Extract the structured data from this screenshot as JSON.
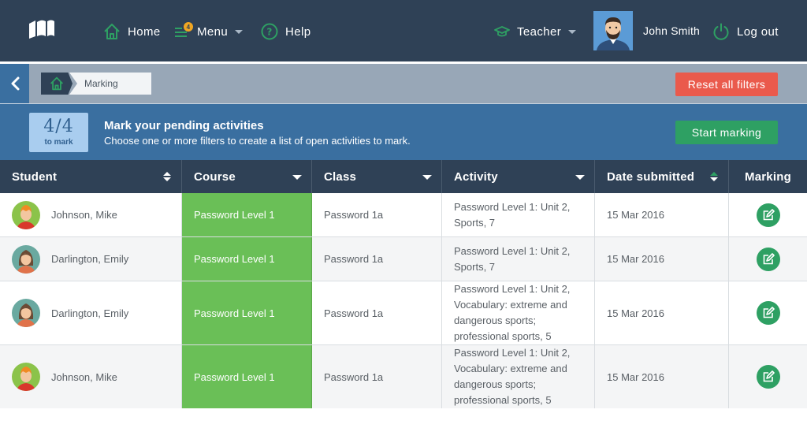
{
  "nav": {
    "home_label": "Home",
    "menu_label": "Menu",
    "menu_badge": "4",
    "help_label": "Help",
    "role_label": "Teacher",
    "user_name": "John Smith",
    "logout_label": "Log out"
  },
  "breadcrumb": {
    "current": "Marking"
  },
  "filters": {
    "reset_label": "Reset all filters"
  },
  "pending": {
    "count": "4/4",
    "count_sub": "to mark",
    "title": "Mark your pending activities",
    "description": "Choose one or more filters to create a list of open activities to mark.",
    "start_label": "Start marking"
  },
  "table": {
    "headers": {
      "student": "Student",
      "course": "Course",
      "class": "Class",
      "activity": "Activity",
      "date": "Date submitted",
      "marking": "Marking"
    },
    "rows": [
      {
        "student": "Johnson, Mike",
        "course": "Password Level 1",
        "class": "Password 1a",
        "activity": "Password Level 1: Unit 2, Sports, 7",
        "date": "15 Mar 2016",
        "avatar": "male-icon"
      },
      {
        "student": "Darlington, Emily",
        "course": "Password Level 1",
        "class": "Password 1a",
        "activity": "Password Level 1: Unit 2, Sports, 7",
        "date": "15 Mar 2016",
        "avatar": "female-icon"
      },
      {
        "student": "Darlington, Emily",
        "course": "Password Level 1",
        "class": "Password 1a",
        "activity": "Password Level 1: Unit 2, Vocabulary: extreme and dangerous sports; professional sports, 5",
        "date": "15 Mar 2016",
        "avatar": "female-icon"
      },
      {
        "student": "Johnson, Mike",
        "course": "Password Level 1",
        "class": "Password 1a",
        "activity": "Password Level 1: Unit 2, Vocabulary: extreme and dangerous sports; professional sports, 5",
        "date": "15 Mar 2016",
        "avatar": "male-icon"
      }
    ]
  },
  "colors": {
    "nav_bg": "#2f4156",
    "accent_green": "#2ea063",
    "course_green": "#6abf57",
    "reset_red": "#ea5a4c",
    "panel_blue": "#3a6fa0"
  }
}
